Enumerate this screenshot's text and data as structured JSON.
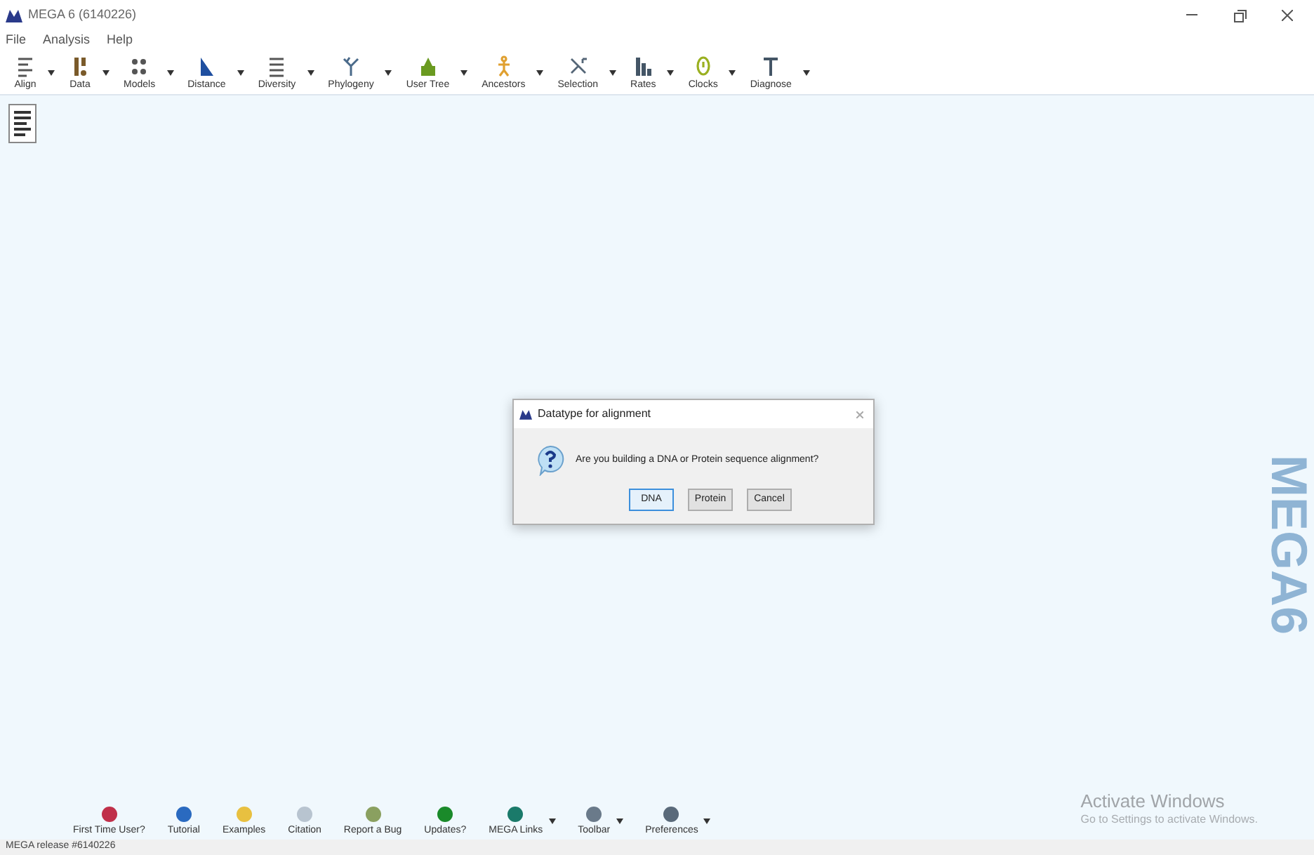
{
  "window": {
    "title": "MEGA 6 (6140226)"
  },
  "menu": [
    "File",
    "Analysis",
    "Help"
  ],
  "toolbar": [
    {
      "label": "Align"
    },
    {
      "label": "Data"
    },
    {
      "label": "Models"
    },
    {
      "label": "Distance"
    },
    {
      "label": "Diversity"
    },
    {
      "label": "Phylogeny"
    },
    {
      "label": "User Tree"
    },
    {
      "label": "Ancestors"
    },
    {
      "label": "Selection"
    },
    {
      "label": "Rates"
    },
    {
      "label": "Clocks"
    },
    {
      "label": "Diagnose"
    }
  ],
  "brand": "MEGA6",
  "dialog": {
    "title": "Datatype for alignment",
    "message": "Are you building a DNA or Protein sequence alignment?",
    "buttons": [
      {
        "label": "DNA",
        "selected": true
      },
      {
        "label": "Protein",
        "selected": false
      },
      {
        "label": "Cancel",
        "selected": false
      }
    ]
  },
  "launch_bar": [
    {
      "label": "First Time User?",
      "menu": false
    },
    {
      "label": "Tutorial",
      "menu": false
    },
    {
      "label": "Examples",
      "menu": false
    },
    {
      "label": "Citation",
      "menu": false
    },
    {
      "label": "Report a Bug",
      "menu": false
    },
    {
      "label": "Updates?",
      "menu": false
    },
    {
      "label": "MEGA Links",
      "menu": true
    },
    {
      "label": "Toolbar",
      "menu": true
    },
    {
      "label": "Preferences",
      "menu": true
    }
  ],
  "activation": {
    "title": "Activate Windows",
    "subtitle": "Go to Settings to activate Windows."
  },
  "status_bar": "MEGA release #6140226"
}
